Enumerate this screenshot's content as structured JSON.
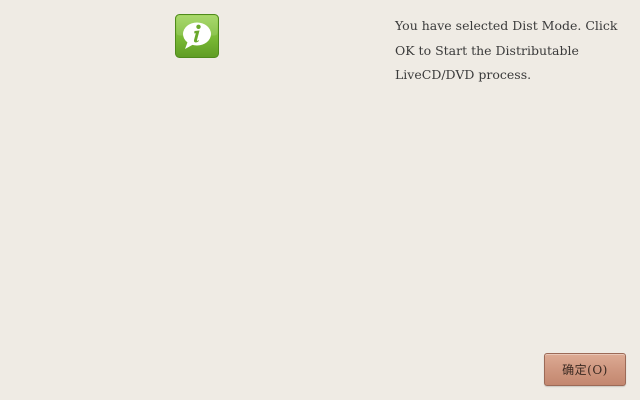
{
  "dialog": {
    "icon": "info-speech-bubble-icon",
    "accent_color": "#79b23a",
    "message": "You have selected Dist Mode.  Click OK to Start the Distributable LiveCD/DVD process."
  },
  "buttons": {
    "ok_label": "确定(O)",
    "ok_color": "#cf9780"
  }
}
